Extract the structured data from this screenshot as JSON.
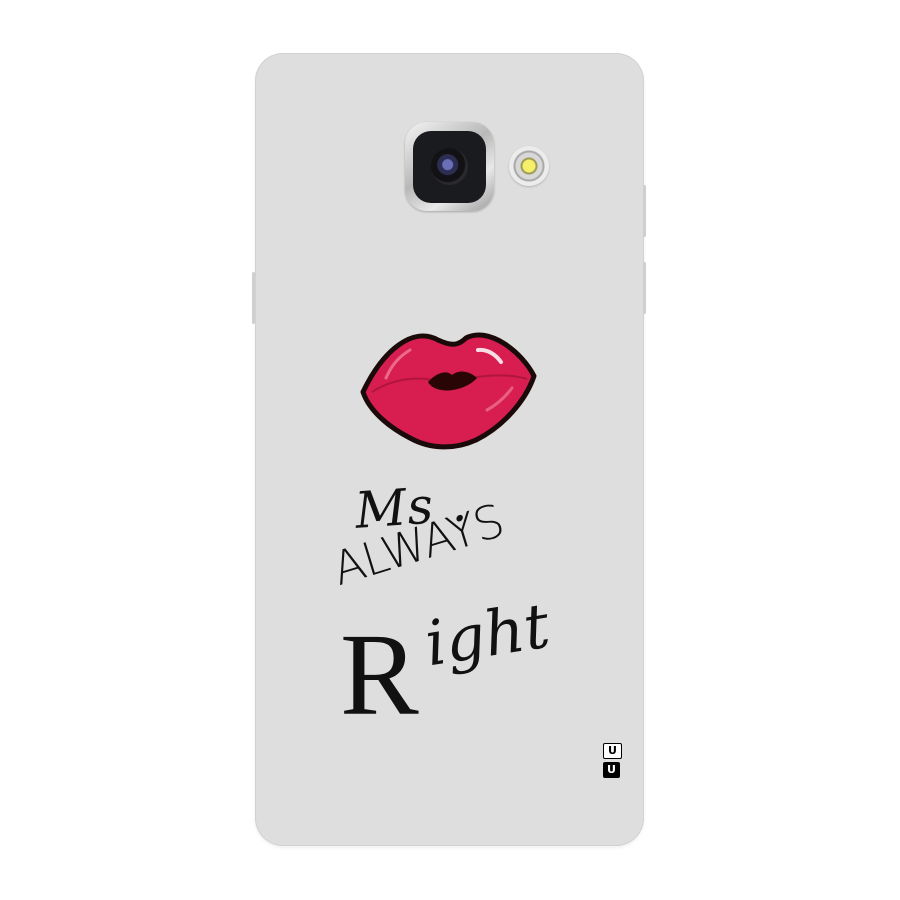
{
  "product": {
    "colors": {
      "case": "#dedede",
      "lips": "#d81e51",
      "lips_outline": "#1a0a0a",
      "text": "#111111"
    },
    "design_text": {
      "line1": "Ms .",
      "line2": "ALWAYS",
      "line3_initial": "R",
      "line3_rest": "ight"
    },
    "brand_mark": {
      "top": "U",
      "bottom": "U"
    },
    "icons": [
      "camera-lens-icon",
      "flash-icon",
      "lips-icon"
    ]
  }
}
